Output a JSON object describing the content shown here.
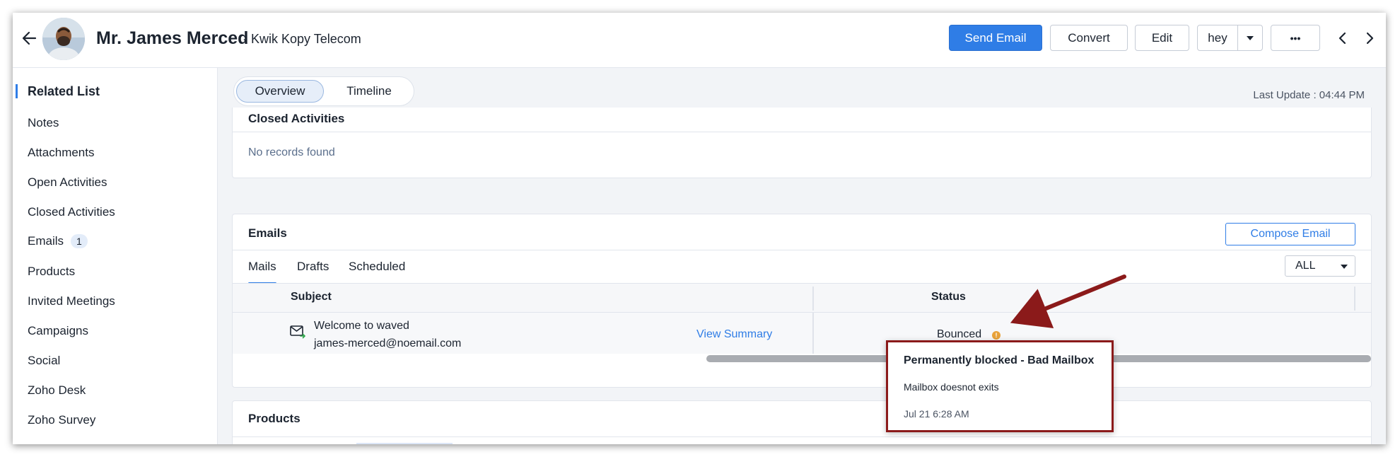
{
  "header": {
    "title": "Mr. James Merced",
    "subtitle": "- Kwik Kopy Telecom",
    "buttons": {
      "send_email": "Send Email",
      "convert": "Convert",
      "edit": "Edit",
      "hey": "hey",
      "more": "•••"
    }
  },
  "sidebar": {
    "heading": "Related List",
    "items": [
      {
        "label": "Notes"
      },
      {
        "label": "Attachments"
      },
      {
        "label": "Open Activities"
      },
      {
        "label": "Closed Activities"
      },
      {
        "label": "Emails",
        "badge": "1"
      },
      {
        "label": "Products"
      },
      {
        "label": "Invited Meetings"
      },
      {
        "label": "Campaigns"
      },
      {
        "label": "Social"
      },
      {
        "label": "Zoho Desk"
      },
      {
        "label": "Zoho Survey"
      }
    ]
  },
  "main": {
    "tabs": [
      {
        "label": "Overview",
        "active": true
      },
      {
        "label": "Timeline",
        "active": false
      }
    ],
    "last_update": "Last Update : 04:44 PM",
    "closed_activities": {
      "title": "Closed Activities",
      "empty": "No records found"
    },
    "emails": {
      "title": "Emails",
      "compose": "Compose Email",
      "tabs": [
        "Mails",
        "Drafts",
        "Scheduled"
      ],
      "filter": "ALL",
      "columns": {
        "subject": "Subject",
        "status": "Status"
      },
      "row": {
        "subject": "Welcome to waved",
        "email": "james-merced@noemail.com",
        "view_summary": "View Summary",
        "status": "Bounced"
      }
    },
    "products": {
      "title": "Products"
    }
  },
  "tooltip": {
    "title": "Permanently blocked - Bad Mailbox",
    "message": "Mailbox doesnot exits",
    "date": "Jul 21 6:28 AM"
  },
  "colors": {
    "primary": "#2f7de6",
    "annotation": "#8b1a1a",
    "warning": "#e8a23a"
  }
}
